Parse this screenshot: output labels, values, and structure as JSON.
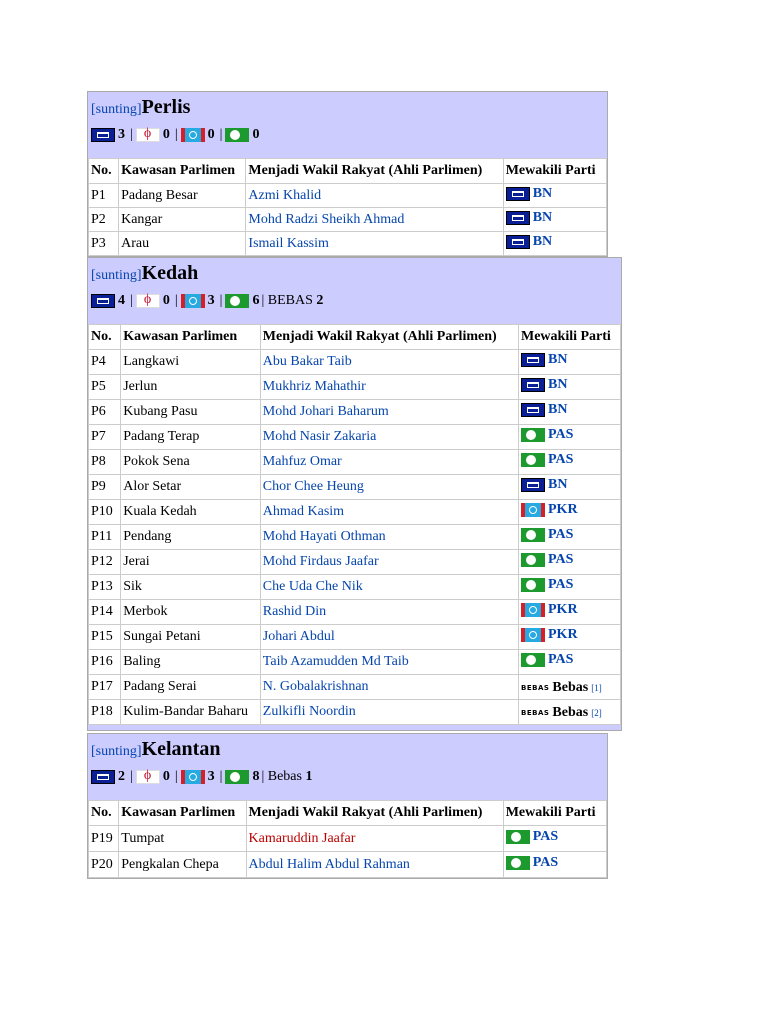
{
  "edit_label": "[sunting]",
  "headers": [
    "No.",
    "Kawasan Parlimen",
    "Menjadi Wakil Rakyat (Ahli Parlimen)",
    "Mewakili Parti"
  ],
  "perlis": {
    "title": "Perlis",
    "tally": {
      "bn": "3",
      "dap": "0",
      "pkr": "0",
      "pas": "0"
    },
    "rows": [
      {
        "no": "P1",
        "seat": "Padang Besar",
        "mp": "Azmi Khalid",
        "party": "BN",
        "flag": "bn-flag-icon"
      },
      {
        "no": "P2",
        "seat": "Kangar",
        "mp": "Mohd Radzi Sheikh Ahmad",
        "party": "BN",
        "flag": "bn-flag-icon"
      },
      {
        "no": "P3",
        "seat": "Arau",
        "mp": "Ismail Kassim",
        "party": "BN",
        "flag": "bn-flag-icon"
      }
    ]
  },
  "kedah": {
    "title": "Kedah",
    "tally": {
      "bn": "4",
      "dap": "0",
      "pkr": "3",
      "pas": "6",
      "extra_label": "| BEBAS",
      "extra_value": "2"
    },
    "rows": [
      {
        "no": "P4",
        "seat": "Langkawi",
        "mp": "Abu Bakar Taib",
        "party": "BN"
      },
      {
        "no": "P5",
        "seat": "Jerlun",
        "mp": "Mukhriz Mahathir",
        "party": "BN"
      },
      {
        "no": "P6",
        "seat": "Kubang Pasu",
        "mp": "Mohd Johari Baharum",
        "party": "BN"
      },
      {
        "no": "P7",
        "seat": "Padang Terap",
        "mp": "Mohd Nasir Zakaria",
        "party": "PAS"
      },
      {
        "no": "P8",
        "seat": "Pokok Sena",
        "mp": "Mahfuz Omar",
        "party": "PAS"
      },
      {
        "no": "P9",
        "seat": "Alor Setar",
        "mp": "Chor Chee Heung",
        "party": "BN"
      },
      {
        "no": "P10",
        "seat": "Kuala Kedah",
        "mp": "Ahmad Kasim",
        "party": "PKR"
      },
      {
        "no": "P11",
        "seat": "Pendang",
        "mp": "Mohd Hayati Othman",
        "party": "PAS"
      },
      {
        "no": "P12",
        "seat": "Jerai",
        "mp": "Mohd Firdaus Jaafar",
        "party": "PAS"
      },
      {
        "no": "P13",
        "seat": "Sik",
        "mp": "Che Uda Che Nik",
        "party": "PAS"
      },
      {
        "no": "P14",
        "seat": "Merbok",
        "mp": "Rashid Din",
        "party": "PKR"
      },
      {
        "no": "P15",
        "seat": "Sungai Petani",
        "mp": "Johari Abdul",
        "party": "PKR"
      },
      {
        "no": "P16",
        "seat": "Baling",
        "mp": "Taib Azamudden Md Taib",
        "party": "PAS"
      },
      {
        "no": "P17",
        "seat": "Padang Serai",
        "mp": "N. Gobalakrishnan",
        "party": "Bebas",
        "ref": "[1]"
      },
      {
        "no": "P18",
        "seat": "Kulim-Bandar Baharu",
        "mp": "Zulkifli Noordin",
        "party": "Bebas",
        "ref": "[2]"
      }
    ]
  },
  "kelantan": {
    "title": "Kelantan",
    "tally": {
      "bn": "2",
      "dap": "0",
      "pkr": "3",
      "pas": "8",
      "extra_label": "| Bebas",
      "extra_value": "1"
    },
    "rows": [
      {
        "no": "P19",
        "seat": "Tumpat",
        "mp": "Kamaruddin Jaafar",
        "party": "PAS",
        "red": true
      },
      {
        "no": "P20",
        "seat": "Pengkalan Chepa",
        "mp": "Abdul Halim Abdul Rahman",
        "party": "PAS"
      }
    ]
  },
  "bebas_mark": "BEBAS",
  "colors": {
    "header_bg": "#ccccff",
    "link": "#0645ad",
    "redlink": "#ba0000"
  }
}
